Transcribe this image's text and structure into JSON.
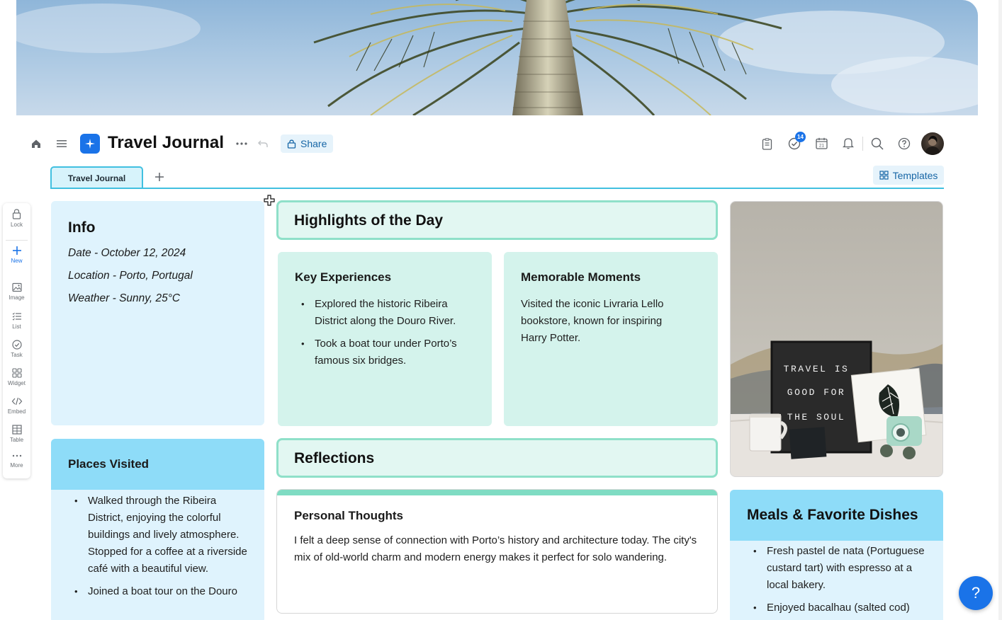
{
  "app": {
    "title": "Travel Journal",
    "share_label": "Share",
    "tasks_badge": "14",
    "calendar_day": "21"
  },
  "tabs": {
    "active_label": "Travel Journal",
    "templates_label": "Templates"
  },
  "toolbar": {
    "items": [
      {
        "label": "Lock",
        "icon": "lock-icon"
      },
      {
        "label": "New",
        "icon": "plus-icon"
      },
      {
        "label": "Image",
        "icon": "image-icon"
      },
      {
        "label": "List",
        "icon": "list-icon"
      },
      {
        "label": "Task",
        "icon": "check-circle-icon"
      },
      {
        "label": "Widget",
        "icon": "widget-icon"
      },
      {
        "label": "Embed",
        "icon": "code-icon"
      },
      {
        "label": "Table",
        "icon": "table-icon"
      },
      {
        "label": "More",
        "icon": "more-icon"
      }
    ]
  },
  "info": {
    "heading": "Info",
    "date": "Date - October 12, 2024",
    "location": "Location - Porto, Portugal",
    "weather": "Weather - Sunny, 25°C"
  },
  "highlights": {
    "heading": "Highlights of the Day",
    "key_experiences": {
      "heading": "Key Experiences",
      "items": [
        "Explored the historic Ribeira District along the Douro River.",
        "Took a boat tour under Porto’s famous six bridges."
      ]
    },
    "memorable_moments": {
      "heading": "Memorable Moments",
      "text": "Visited the iconic Livraria Lello bookstore, known for inspiring Harry Potter."
    }
  },
  "photo": {
    "sign_lines": [
      "TRAVEL IS",
      "GOOD FOR",
      "THE SOUL"
    ]
  },
  "places": {
    "heading": "Places Visited",
    "items": [
      "Walked through the Ribeira District, enjoying the colorful buildings and lively atmosphere. Stopped for a coffee at a riverside café with a beautiful view.",
      "Joined a boat tour on the Douro"
    ]
  },
  "reflections": {
    "heading": "Reflections",
    "thoughts_heading": "Personal Thoughts",
    "thoughts_text": "I felt a deep sense of connection with Porto’s history and architecture today. The city's mix of old-world charm and modern energy makes it perfect for solo wandering."
  },
  "meals": {
    "heading": "Meals & Favorite Dishes",
    "items": [
      "Fresh pastel de nata (Portuguese custard tart) with espresso at a local bakery.",
      "Enjoyed bacalhau (salted cod)"
    ]
  },
  "help": {
    "label": "?"
  },
  "colors": {
    "accent": "#1a73e8",
    "tab_line": "#41c0e0",
    "info_bg": "#dff3fd",
    "mint_bg": "#d4f3ec",
    "mint_border": "#8fe0c9",
    "head_blue": "#8edcf8"
  }
}
